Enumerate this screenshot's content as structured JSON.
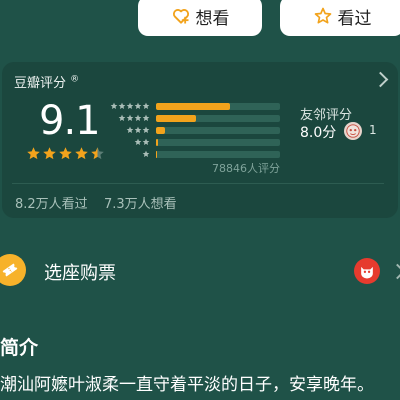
{
  "actions": {
    "want_label": "想看",
    "seen_label": "看过"
  },
  "rating": {
    "brand": "豆瓣评分",
    "brand_mark": "®",
    "score": "9.1",
    "stars": 4.5,
    "distribution": [
      {
        "stars": 5,
        "fraction": 0.6
      },
      {
        "stars": 4,
        "fraction": 0.32
      },
      {
        "stars": 3,
        "fraction": 0.07
      },
      {
        "stars": 2,
        "fraction": 0.015
      },
      {
        "stars": 1,
        "fraction": 0.01
      }
    ],
    "count_text": "78846人评分",
    "friend_title": "友邻评分",
    "friend_score": "8.0分",
    "friend_count": "1",
    "watched_text": "8.2万人看过",
    "wanting_text": "7.3万人想看"
  },
  "ticket": {
    "label": "选座购票"
  },
  "intro": {
    "title": "简介",
    "text": "潮汕阿嬷叶淑柔一直守着平淡的日子，安享晚年。"
  },
  "colors": {
    "background": "#1f5248",
    "accent_star": "#f2a31c",
    "ticket_icon": "#f7b22a"
  }
}
